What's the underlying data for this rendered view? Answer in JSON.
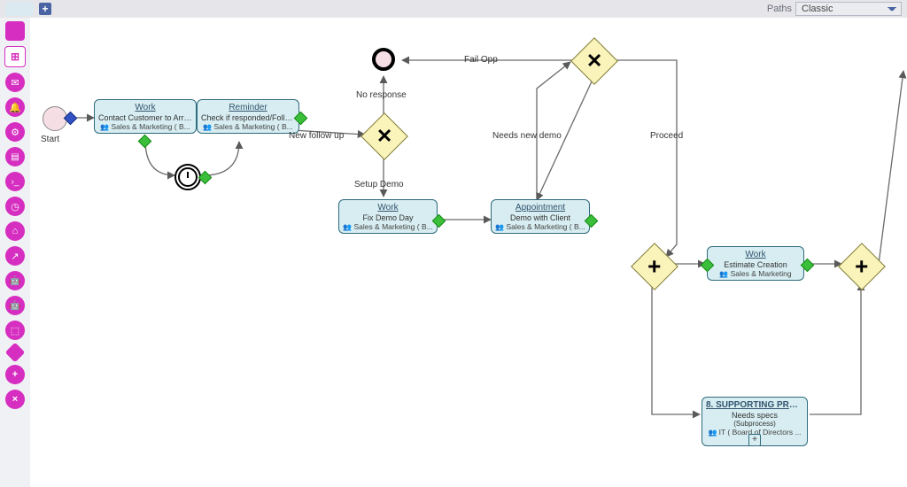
{
  "topbar": {
    "paths_label": "Paths",
    "paths_selected": "Classic",
    "paths_options": [
      "Classic"
    ]
  },
  "palette": {
    "accent": "#d62ec0",
    "items": [
      {
        "name": "task-tool",
        "glyph": "square"
      },
      {
        "name": "subprocess-tool",
        "glyph": "sub"
      },
      {
        "name": "message-tool",
        "glyph": "mail"
      },
      {
        "name": "notify-tool",
        "glyph": "bell"
      },
      {
        "name": "gears-tool",
        "glyph": "gears"
      },
      {
        "name": "data-tool",
        "glyph": "db"
      },
      {
        "name": "more-tool",
        "glyph": "more"
      },
      {
        "name": "timer-tool",
        "glyph": "timer"
      },
      {
        "name": "cloud-tool",
        "glyph": "cloud"
      },
      {
        "name": "export-tool",
        "glyph": "export"
      },
      {
        "name": "robot1-tool",
        "glyph": "robot"
      },
      {
        "name": "robot2-tool",
        "glyph": "robot"
      },
      {
        "name": "assign-tool",
        "glyph": "user"
      },
      {
        "name": "gateway-tool",
        "glyph": "diamond"
      },
      {
        "name": "add-tool",
        "glyph": "plus"
      },
      {
        "name": "cancel-tool",
        "glyph": "x"
      }
    ]
  },
  "labels": {
    "start": "Start",
    "no_response": "No response",
    "fail_opp": "Fail Opp",
    "needs_new_demo": "Needs new demo",
    "proceed": "Proceed",
    "new_follow_up": "New follow up",
    "setup_demo": "Setup Demo"
  },
  "tasks": {
    "contact": {
      "title": "Work",
      "body": "Contact Customer to Arra...",
      "lane": "Sales & Marketing ( B..."
    },
    "reminder": {
      "title": "Reminder",
      "body": "Check if responded/Follow...",
      "lane": "Sales & Marketing ( B..."
    },
    "fixdemo": {
      "title": "Work",
      "body": "Fix Demo Day",
      "lane": "Sales & Marketing ( B..."
    },
    "appointment": {
      "title": "Appointment",
      "body": "Demo with Client",
      "lane": "Sales & Marketing ( B..."
    },
    "estimate": {
      "title": "Work",
      "body": "Estimate Creation",
      "lane": "Sales & Marketing"
    },
    "supporting": {
      "title": "8. SUPPORTING PROC...",
      "body": "Needs specs",
      "sub": "(Subprocess)",
      "lane": "IT ( Board of Directors ..."
    }
  },
  "chart_data": {
    "type": "diagram",
    "notation": "BPMN-like process",
    "nodes": [
      {
        "id": "start",
        "type": "start-event",
        "label": "Start"
      },
      {
        "id": "contact",
        "type": "task",
        "title": "Work",
        "body": "Contact Customer to Arra...",
        "lane": "Sales & Marketing ( B..."
      },
      {
        "id": "timer",
        "type": "timer-event"
      },
      {
        "id": "reminder",
        "type": "task",
        "title": "Reminder",
        "body": "Check if responded/Follow...",
        "lane": "Sales & Marketing ( B..."
      },
      {
        "id": "gw1",
        "type": "exclusive-gateway"
      },
      {
        "id": "end",
        "type": "end-event",
        "label": "No response"
      },
      {
        "id": "fixdemo",
        "type": "task",
        "title": "Work",
        "body": "Fix Demo Day",
        "lane": "Sales & Marketing ( B..."
      },
      {
        "id": "appt",
        "type": "task",
        "title": "Appointment",
        "body": "Demo with Client",
        "lane": "Sales & Marketing ( B..."
      },
      {
        "id": "gw2",
        "type": "exclusive-gateway"
      },
      {
        "id": "pgw_in",
        "type": "parallel-gateway"
      },
      {
        "id": "estimate",
        "type": "task",
        "title": "Work",
        "body": "Estimate Creation",
        "lane": "Sales & Marketing"
      },
      {
        "id": "support",
        "type": "call-activity",
        "title": "8. SUPPORTING PROC...",
        "body": "Needs specs (Subprocess)",
        "lane": "IT ( Board of Directors ..."
      },
      {
        "id": "pgw_out",
        "type": "parallel-gateway"
      }
    ],
    "edges": [
      {
        "from": "start",
        "to": "contact"
      },
      {
        "from": "contact",
        "to": "timer"
      },
      {
        "from": "timer",
        "to": "reminder"
      },
      {
        "from": "reminder",
        "to": "gw1",
        "label": "New follow up"
      },
      {
        "from": "gw1",
        "to": "end",
        "label": "No response"
      },
      {
        "from": "gw1",
        "to": "fixdemo",
        "label": "Setup Demo"
      },
      {
        "from": "fixdemo",
        "to": "appt"
      },
      {
        "from": "appt",
        "to": "gw2"
      },
      {
        "from": "gw2",
        "to": "end",
        "label": "Fail Opp"
      },
      {
        "from": "gw2",
        "to": "appt",
        "label": "Needs new demo"
      },
      {
        "from": "gw2",
        "to": "pgw_in",
        "label": "Proceed"
      },
      {
        "from": "pgw_in",
        "to": "estimate"
      },
      {
        "from": "pgw_in",
        "to": "support"
      },
      {
        "from": "estimate",
        "to": "pgw_out"
      },
      {
        "from": "support",
        "to": "pgw_out"
      }
    ]
  }
}
